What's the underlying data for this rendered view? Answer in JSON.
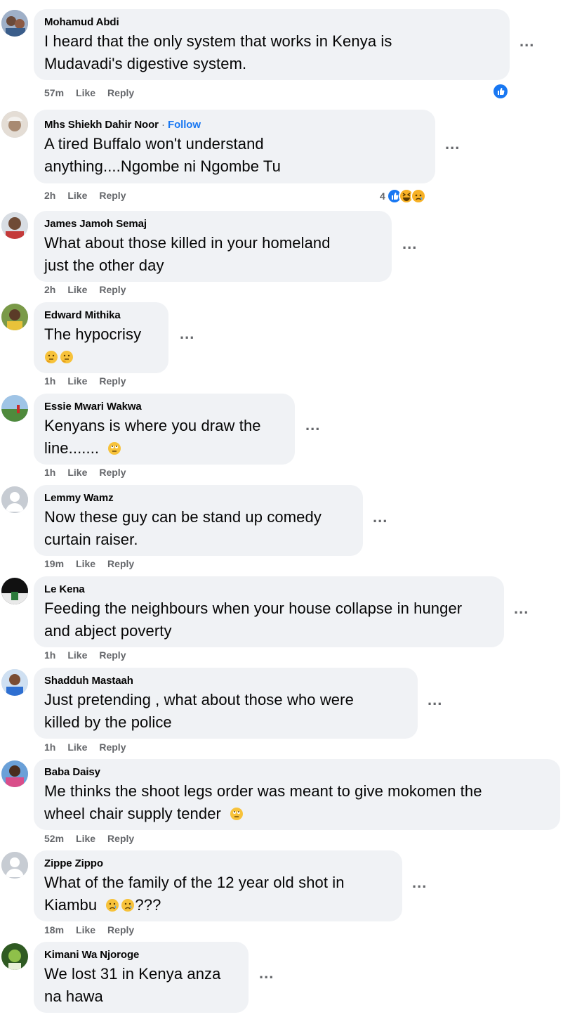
{
  "colors": {
    "bubble": "#f0f2f5",
    "meta_text": "#65676b",
    "link_blue": "#1877f2",
    "haha_yellow": "#f7b125",
    "sad_yellow": "#f7b125"
  },
  "comments": [
    {
      "name": "Mohamud Abdi",
      "line1": "I heard that the only system that works in Kenya is",
      "line2": "Mudavadi's digestive system.",
      "time": "57m",
      "like": "Like",
      "reply": "Reply",
      "more": "...",
      "reaction_icons": [
        "like-icon"
      ]
    },
    {
      "name": "Mhs Shiekh Dahir Noor",
      "follow_sep": "·",
      "follow": "Follow",
      "line1": "A tired Buffalo won't understand",
      "line2": "anything....Ngombe ni Ngombe Tu",
      "time": "2h",
      "like": "Like",
      "reply": "Reply",
      "more": "...",
      "reaction_count": "4",
      "reaction_icons": [
        "like-icon",
        "haha-icon",
        "sad-icon"
      ]
    },
    {
      "name": "James Jamoh Semaj",
      "line1": "What about those killed in your homeland",
      "line2": "just the other day",
      "time": "2h",
      "like": "Like",
      "reply": "Reply",
      "more": "..."
    },
    {
      "name": "Edward Mithika",
      "line1": "The hypocrisy",
      "time": "1h",
      "like": "Like",
      "reply": "Reply",
      "more": "...",
      "emojis": [
        "thinking-face-icon",
        "thinking-face-icon"
      ]
    },
    {
      "name": "Essie Mwari Wakwa",
      "line1": "Kenyans is where you draw the",
      "line2": "line.......",
      "time": "1h",
      "like": "Like",
      "reply": "Reply",
      "more": "...",
      "emojis": [
        "eye-roll-face-icon"
      ]
    },
    {
      "name": "Lemmy Wamz",
      "line1": "Now these guy can be stand up comedy",
      "line2": "curtain raiser.",
      "time": "19m",
      "like": "Like",
      "reply": "Reply",
      "more": "..."
    },
    {
      "name": "Le Kena",
      "line1": "Feeding the neighbours when your house collapse in hunger",
      "line2": "and abject poverty",
      "time": "1h",
      "like": "Like",
      "reply": "Reply",
      "more": "..."
    },
    {
      "name": "Shadduh Mastaah",
      "line1": "Just pretending , what about those who were",
      "line2": "killed by the police",
      "time": "1h",
      "like": "Like",
      "reply": "Reply",
      "more": "..."
    },
    {
      "name": "Baba Daisy",
      "line1": "Me thinks the shoot legs order was meant to give mokomen the",
      "line2": "wheel chair supply tender",
      "time": "52m",
      "like": "Like",
      "reply": "Reply",
      "more": "...",
      "emojis": [
        "eye-roll-face-icon"
      ]
    },
    {
      "name": "Zippe Zippo",
      "line1": "What of the family of the 12 year old shot in",
      "line2": "Kiambu",
      "line2_suffix": "???",
      "time": "18m",
      "like": "Like",
      "reply": "Reply",
      "more": "...",
      "emojis": [
        "crying-face-icon",
        "crying-face-icon"
      ]
    },
    {
      "name": "Kimani Wa Njoroge",
      "line1": "We lost 31 in Kenya anza",
      "line2": "na hawa",
      "more": "..."
    }
  ]
}
